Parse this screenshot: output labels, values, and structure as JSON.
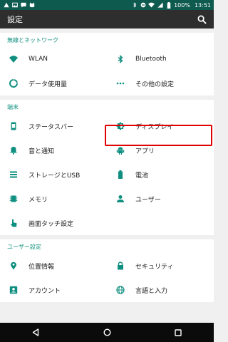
{
  "status_bar": {
    "time": "13:51",
    "battery": "100%",
    "left_icons": [
      "warning-icon",
      "image-icon",
      "message-icon",
      "cat-icon"
    ],
    "right_icons": [
      "bluetooth-icon",
      "minus-icon",
      "wifi-icon",
      "signal-icon",
      "battery-icon"
    ]
  },
  "app_bar": {
    "title": "設定",
    "search_icon": "search-icon"
  },
  "sections": [
    {
      "header": "無線とネットワーク",
      "items": [
        {
          "icon": "wifi-icon",
          "label": "WLAN"
        },
        {
          "icon": "bluetooth-icon",
          "label": "Bluetooth"
        },
        {
          "icon": "data-usage-icon",
          "label": "データ使用量"
        },
        {
          "icon": "more-icon",
          "label": "その他の設定"
        }
      ]
    },
    {
      "header": "端末",
      "items": [
        {
          "icon": "status-bar-icon",
          "label": "ステータスバー"
        },
        {
          "icon": "display-icon",
          "label": "ディスプレイ"
        },
        {
          "icon": "bell-icon",
          "label": "音と通知"
        },
        {
          "icon": "android-icon",
          "label": "アプリ"
        },
        {
          "icon": "storage-icon",
          "label": "ストレージとUSB"
        },
        {
          "icon": "battery-icon",
          "label": "電池"
        },
        {
          "icon": "memory-icon",
          "label": "メモリ"
        },
        {
          "icon": "user-icon",
          "label": "ユーザー"
        },
        {
          "icon": "touch-icon",
          "label": "画面タッチ設定"
        }
      ]
    },
    {
      "header": "ユーザー設定",
      "items": [
        {
          "icon": "location-icon",
          "label": "位置情報"
        },
        {
          "icon": "lock-icon",
          "label": "セキュリティ"
        },
        {
          "icon": "account-icon",
          "label": "アカウント"
        },
        {
          "icon": "globe-icon",
          "label": "言語と入力"
        }
      ]
    }
  ],
  "nav_bar": {
    "buttons": [
      "back-icon",
      "home-icon",
      "recents-icon"
    ]
  },
  "colors": {
    "accent": "#0f8f7f",
    "status_bar": "#0f5a4f",
    "app_bar": "#2e2e2e",
    "highlight": "#e00000"
  }
}
